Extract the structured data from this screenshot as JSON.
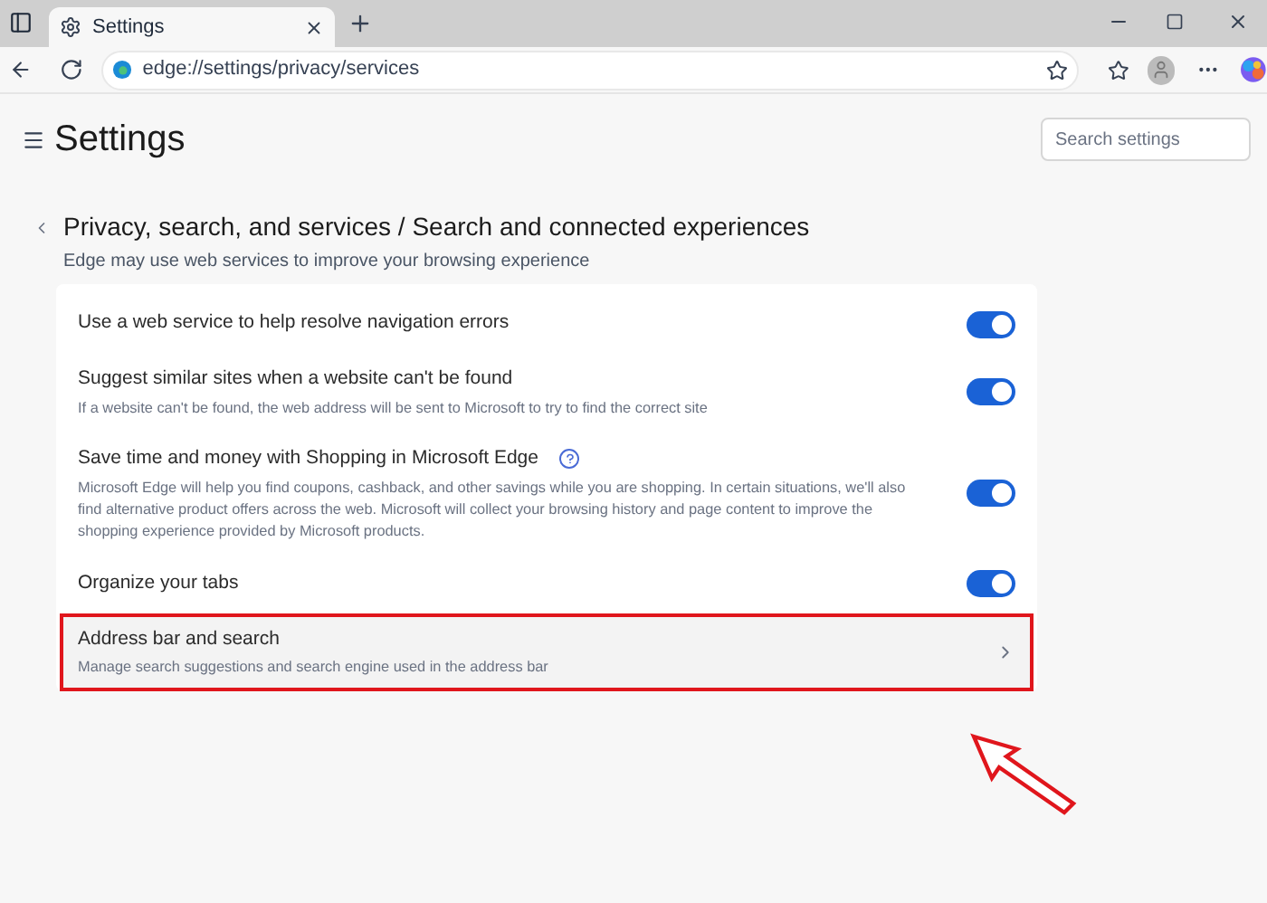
{
  "browser": {
    "tab": {
      "title": "Settings"
    },
    "address": "edge://settings/privacy/services"
  },
  "settings": {
    "title": "Settings",
    "search": {
      "placeholder": "Search settings"
    }
  },
  "page": {
    "breadcrumb": "Privacy, search, and services / Search and connected experiences",
    "subtitle": "Edge may use web services to improve your browsing experience"
  },
  "items": [
    {
      "kind": "toggle",
      "title": "Use a web service to help resolve navigation errors",
      "on": true,
      "highlighted": false
    },
    {
      "kind": "toggle",
      "title": "Suggest similar sites when a website can't be found",
      "description": "If a website can't be found, the web address will be sent to Microsoft to try to find the correct site",
      "on": true,
      "highlighted": false
    },
    {
      "kind": "toggle",
      "title": "Save time and money with Shopping in Microsoft Edge",
      "help": true,
      "description": "Microsoft Edge will help you find coupons, cashback, and other savings while you are shopping. In certain situations, we'll also find alternative product offers across the web. Microsoft will collect your browsing history and page content to improve the shopping experience provided by Microsoft products.",
      "on": true,
      "highlighted": false
    },
    {
      "kind": "toggle",
      "title": "Organize your tabs",
      "on": true,
      "highlighted": false
    },
    {
      "kind": "link",
      "title": "Address bar and search",
      "description": "Manage search suggestions and search engine used in the address bar",
      "highlighted": true
    }
  ]
}
